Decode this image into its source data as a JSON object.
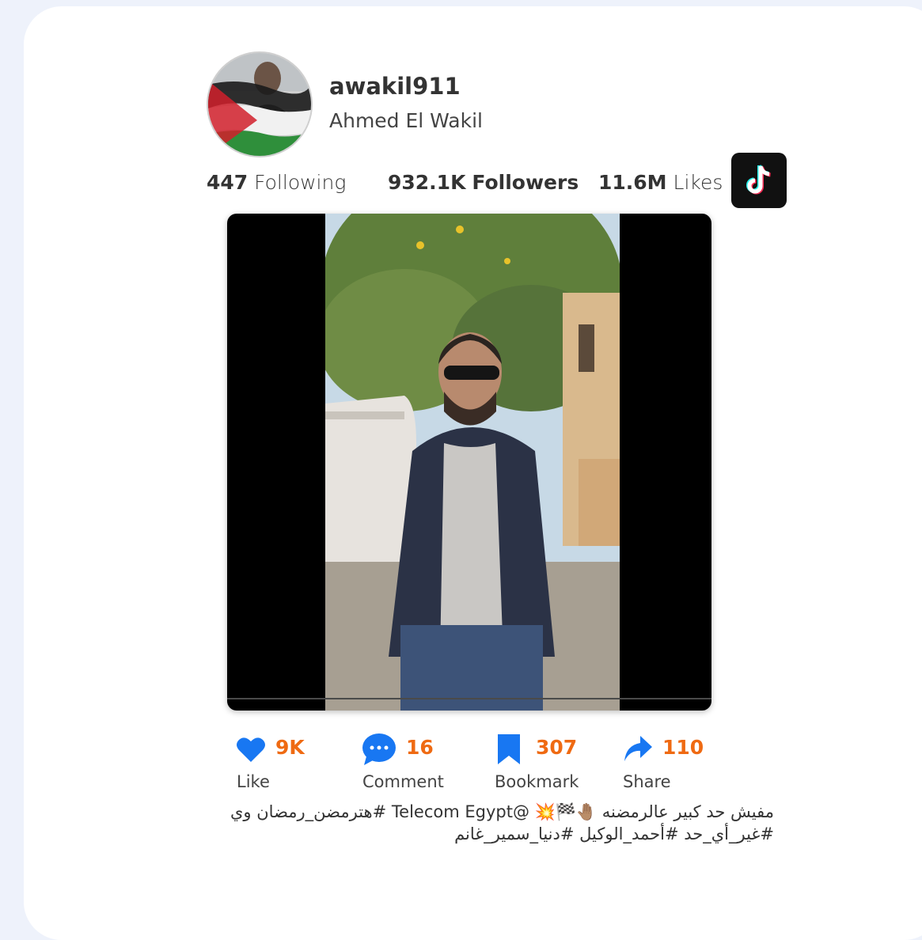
{
  "profile": {
    "username": "awakil911",
    "display_name": "Ahmed El Wakil"
  },
  "stats": {
    "following_count": "447",
    "following_label": "Following",
    "followers_count": "932.1K",
    "followers_label": "Followers",
    "likes_count": "11.6M",
    "likes_label": "Likes"
  },
  "actions": {
    "like": {
      "count": "9K",
      "label": "Like",
      "icon": "heart-icon"
    },
    "comment": {
      "count": "16",
      "label": "Comment",
      "icon": "speech-bubble-icon"
    },
    "bookmark": {
      "count": "307",
      "label": "Bookmark",
      "icon": "bookmark-icon"
    },
    "share": {
      "count": "110",
      "label": "Share",
      "icon": "share-arrow-icon"
    }
  },
  "caption": "مفيش حد كبير عالرمضنه 🤚🏽🏁💥 @Telecom Egypt #هترمضن_رمضان وي #غير_أي_حد #أحمد_الوكيل #دنيا_سمير_غانم",
  "colors": {
    "background": "#eef2fb",
    "accent_count": "#ef6a12",
    "icon_blue": "#1877f2"
  }
}
